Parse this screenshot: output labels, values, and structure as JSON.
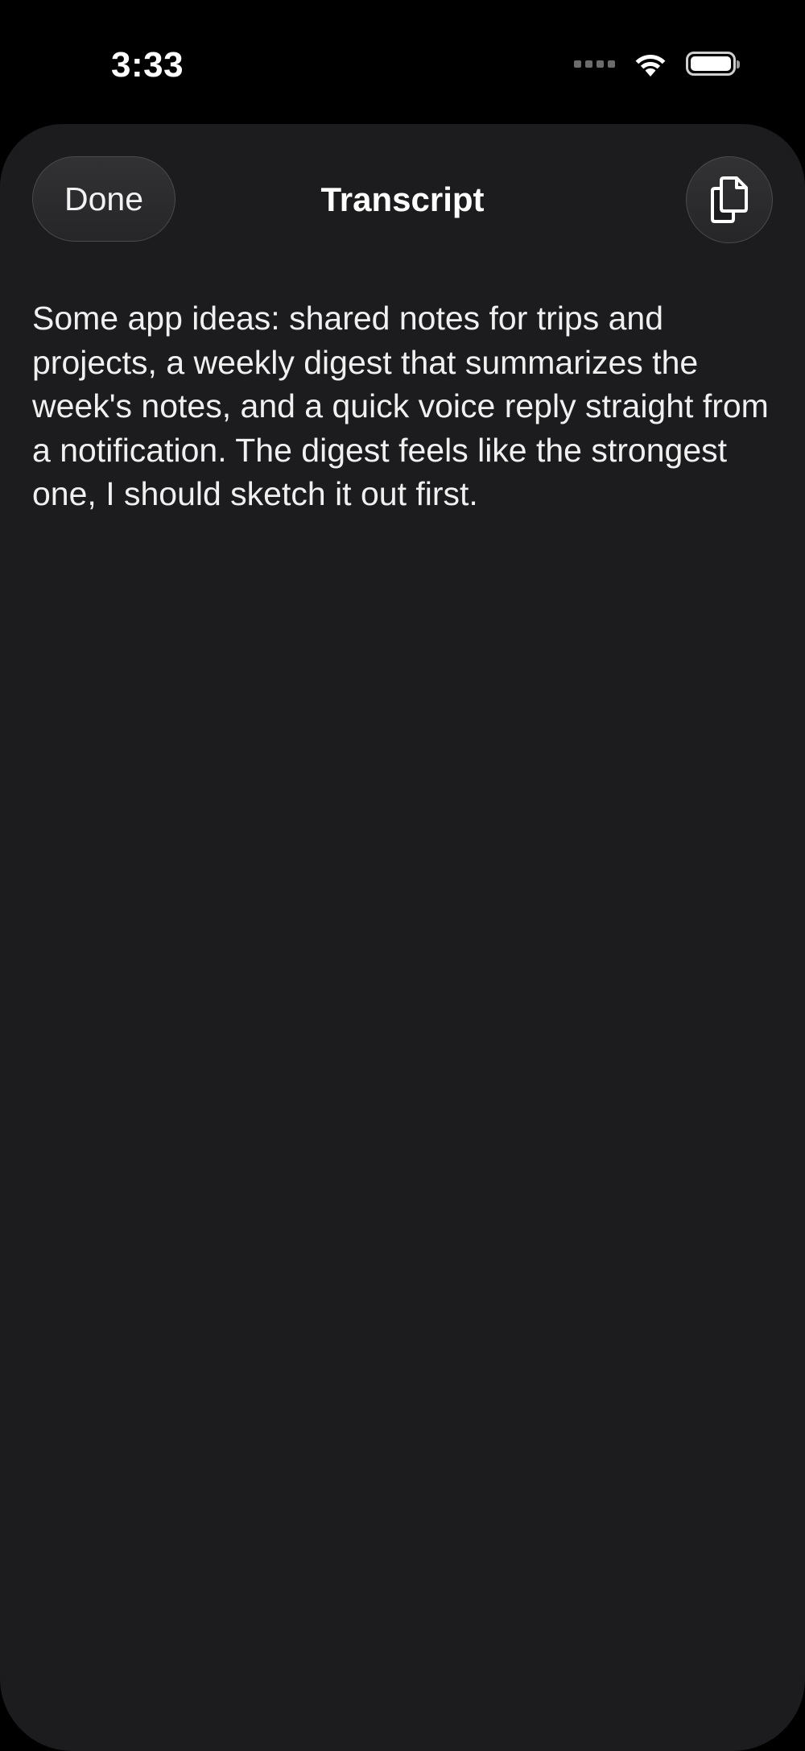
{
  "status_bar": {
    "time": "3:33",
    "icons": [
      "signal-dots-icon",
      "wifi-icon",
      "battery-icon"
    ]
  },
  "sheet": {
    "done_label": "Done",
    "title": "Transcript",
    "copy_icon": "copy-icon",
    "transcript": "Some app ideas: shared notes for trips and projects, a weekly digest that summarizes the week's notes, and a quick voice reply straight from a notification. The digest feels like the strongest one, I should sketch it out first."
  },
  "colors": {
    "background": "#000000",
    "sheet_background": "#1c1c1e",
    "text": "#ffffff"
  }
}
